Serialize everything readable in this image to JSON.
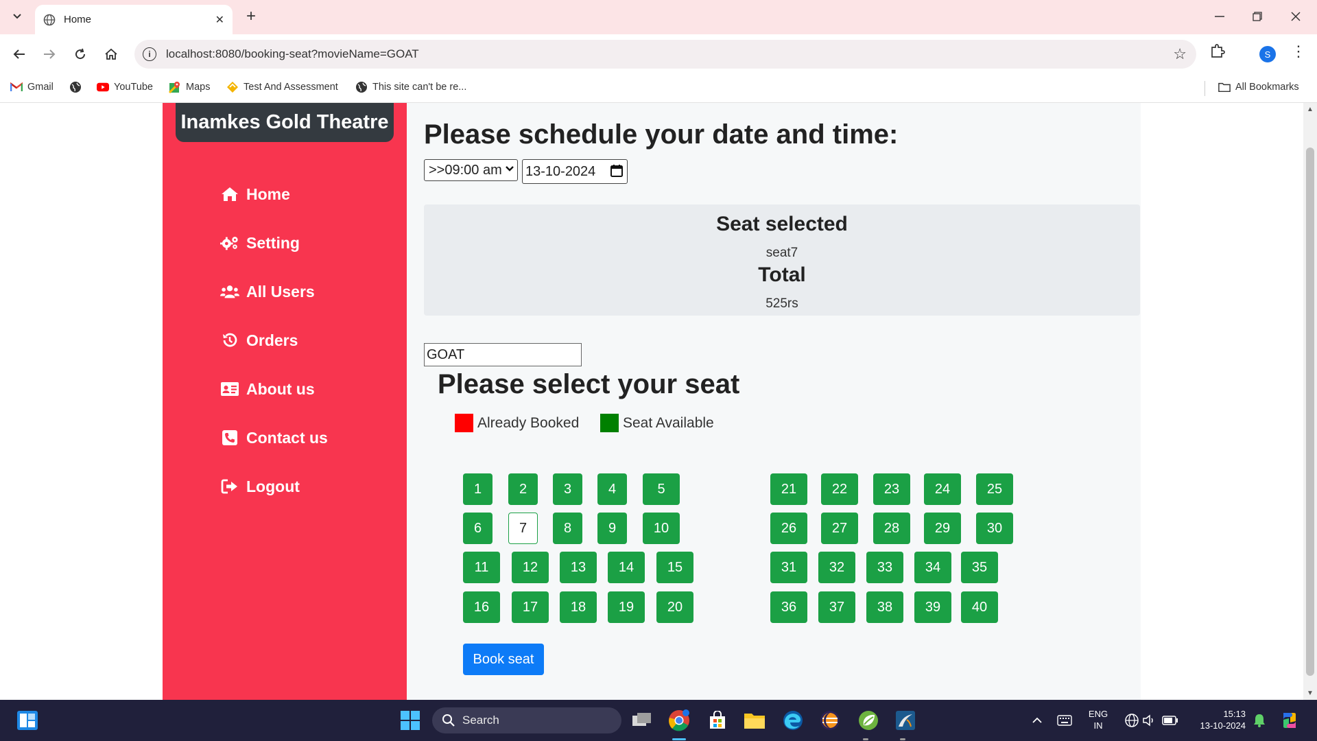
{
  "browser": {
    "tab_title": "Home",
    "url": "localhost:8080/booking-seat?movieName=GOAT",
    "profile_initial": "S",
    "bookmarks": [
      "Gmail",
      "YouTube",
      "Maps",
      "Test And Assessment",
      "This site can't be re..."
    ],
    "all_bookmarks": "All Bookmarks"
  },
  "sidebar": {
    "brand": "Inamkes Gold Theatre",
    "items": [
      {
        "label": "Home",
        "icon": "home-icon"
      },
      {
        "label": "Setting",
        "icon": "gears-icon"
      },
      {
        "label": "All Users",
        "icon": "users-icon"
      },
      {
        "label": "Orders",
        "icon": "history-icon"
      },
      {
        "label": "About us",
        "icon": "id-card-icon"
      },
      {
        "label": "Contact us",
        "icon": "phone-icon"
      },
      {
        "label": "Logout",
        "icon": "logout-icon"
      }
    ]
  },
  "schedule": {
    "heading": "Please schedule your date and time:",
    "time_value": ">>09:00 am",
    "date_value": "13-10-2024"
  },
  "summary": {
    "seat_heading": "Seat selected",
    "seat_value": "seat7",
    "total_heading": "Total",
    "total_value": "525rs"
  },
  "movie_name": "GOAT",
  "seat_heading": "Please select your seat",
  "legend": {
    "booked": "Already Booked",
    "booked_color": "#ff0000",
    "available": "Seat Available",
    "available_color": "#008000"
  },
  "seats": {
    "left_rows": [
      [
        "1",
        "2",
        "3",
        "4",
        "5"
      ],
      [
        "6",
        "7",
        "8",
        "9",
        "10"
      ],
      [
        "11",
        "12",
        "13",
        "14",
        "15"
      ],
      [
        "16",
        "17",
        "18",
        "19",
        "20"
      ]
    ],
    "right_rows": [
      [
        "21",
        "22",
        "23",
        "24",
        "25"
      ],
      [
        "26",
        "27",
        "28",
        "29",
        "30"
      ],
      [
        "31",
        "32",
        "33",
        "34",
        "35"
      ],
      [
        "36",
        "37",
        "38",
        "39",
        "40"
      ]
    ],
    "selected": "7",
    "seat_color": "#1ba045"
  },
  "book_button": "Book seat",
  "taskbar": {
    "search": "Search",
    "lang": "ENG",
    "region": "IN",
    "time": "15:13",
    "date": "13-10-2024"
  }
}
